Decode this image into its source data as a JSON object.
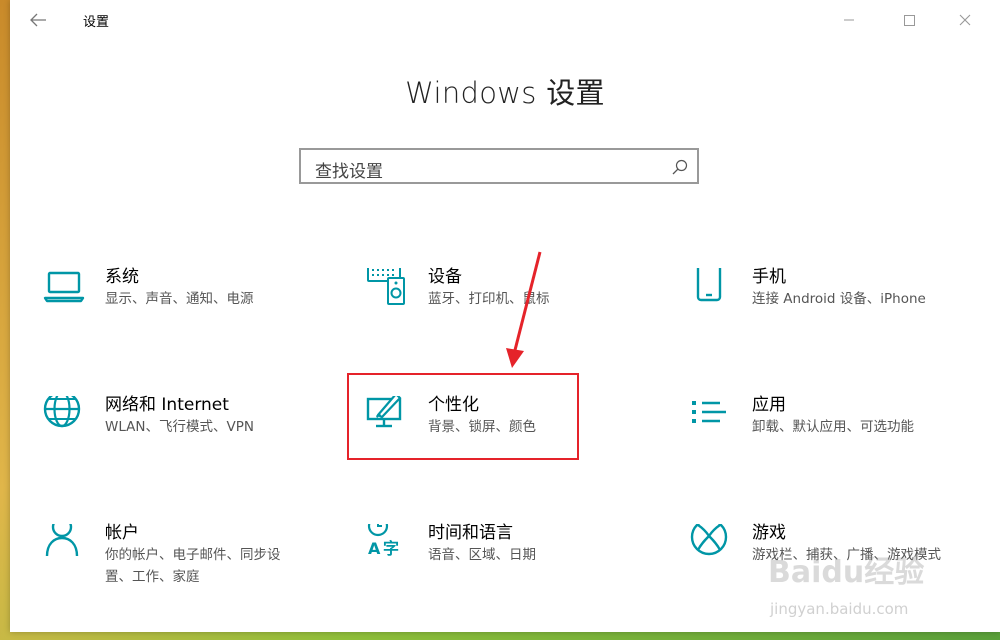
{
  "window": {
    "title": "设置"
  },
  "heading": "Windows 设置",
  "search": {
    "placeholder": "查找设置"
  },
  "tiles": [
    {
      "title": "系统",
      "desc": "显示、声音、通知、电源",
      "icon": "laptop-icon"
    },
    {
      "title": "设备",
      "desc": "蓝牙、打印机、鼠标",
      "icon": "devices-icon"
    },
    {
      "title": "手机",
      "desc": "连接 Android 设备、iPhone",
      "icon": "phone-icon"
    },
    {
      "title": "网络和 Internet",
      "desc": "WLAN、飞行模式、VPN",
      "icon": "globe-icon"
    },
    {
      "title": "个性化",
      "desc": "背景、锁屏、颜色",
      "icon": "personalization-icon"
    },
    {
      "title": "应用",
      "desc": "卸载、默认应用、可选功能",
      "icon": "apps-list-icon"
    },
    {
      "title": "帐户",
      "desc": "你的帐户、电子邮件、同步设置、工作、家庭",
      "desc_line1": "你的帐户、电子邮件、同步设",
      "desc_line2": "置、工作、家庭",
      "icon": "person-icon"
    },
    {
      "title": "时间和语言",
      "desc": "语音、区域、日期",
      "icon": "time-language-icon"
    },
    {
      "title": "游戏",
      "desc": "游戏栏、捕获、广播、游戏模式",
      "desc_visible": "游戏栏、捕获、广播、游戏模式",
      "icon": "xbox-icon"
    }
  ],
  "watermark": {
    "brand": "Baidu经验",
    "url": "jingyan.baidu.com"
  },
  "colors": {
    "accent": "#0096a6",
    "highlight": "#e5232a"
  }
}
